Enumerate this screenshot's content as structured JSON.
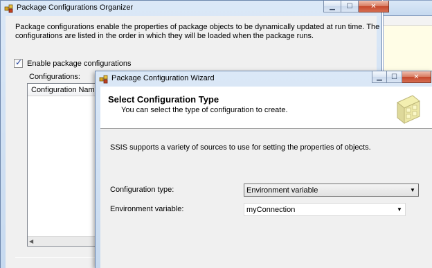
{
  "organizer": {
    "title": "Package Configurations Organizer",
    "description": "Package configurations enable the properties of package objects to be dynamically updated at run time. The configurations are listed in the order in which they will be loaded when the package runs.",
    "enable_label": "Enable package configurations",
    "enable_checked": true,
    "configurations_label": "Configurations:",
    "columns": [
      "Configuration Name"
    ]
  },
  "wizard": {
    "title": "Package Configuration Wizard",
    "header_title": "Select Configuration Type",
    "header_subtitle": "You can select the type of configuration to create.",
    "intro": "SSIS supports a variety of sources to use for setting the properties of objects.",
    "config_type_label": "Configuration type:",
    "config_type_value": "Environment variable",
    "env_var_label": "Environment variable:",
    "env_var_value": "myConnection"
  },
  "icons": {
    "window_buttons": [
      "minimize-icon",
      "maximize-icon",
      "close-icon"
    ],
    "dropdown": "chevron-down-icon",
    "checkmark": "✓"
  },
  "colors": {
    "titlebar": "#c6d9ef",
    "close_button": "#c5472b",
    "dialog_face": "#f0f0f0"
  }
}
